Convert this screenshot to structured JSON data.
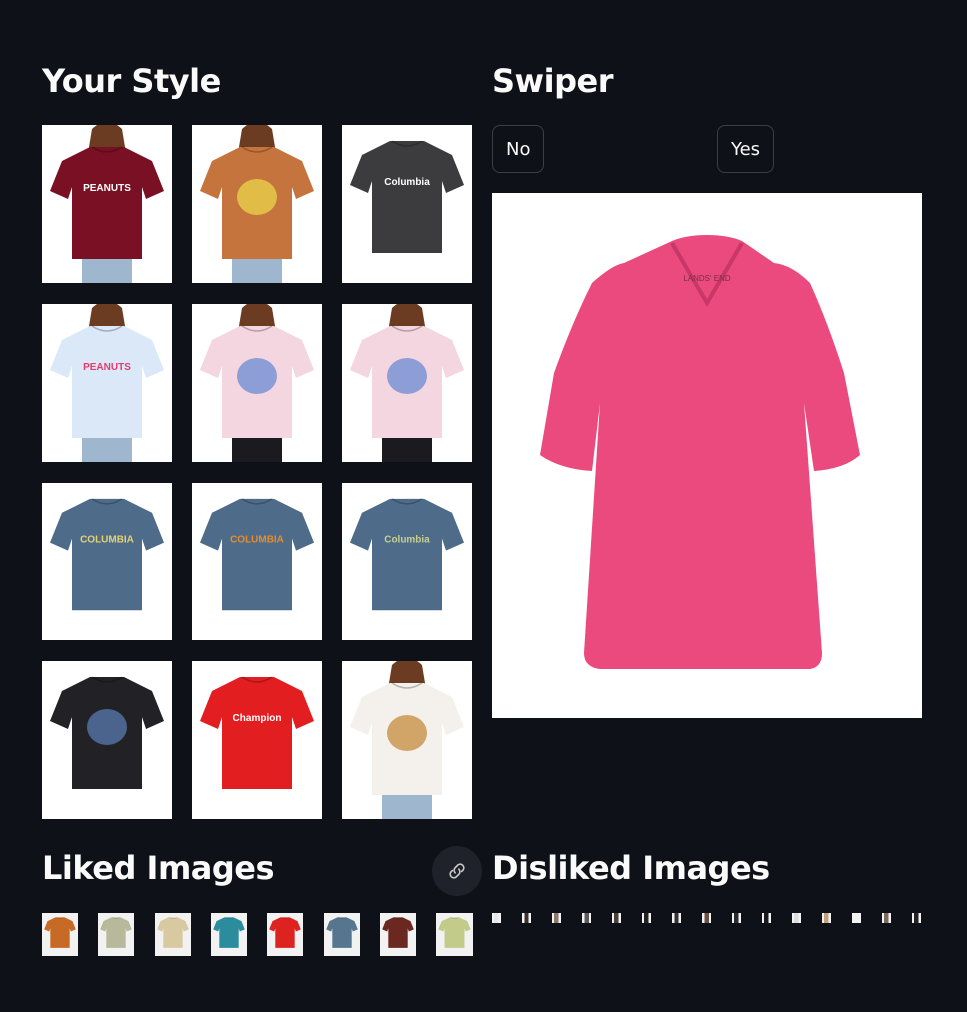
{
  "style_section": {
    "title": "Your Style"
  },
  "swiper_section": {
    "title": "Swiper",
    "no_label": "No",
    "yes_label": "Yes"
  },
  "liked_section": {
    "title": "Liked Images",
    "link_icon": "link-icon"
  },
  "disliked_section": {
    "title": "Disliked Images",
    "count": 15
  },
  "style_tiles": [
    {
      "shirt": "#7a1024",
      "kind": "model",
      "print": "PEANUTS",
      "print_color": "#ffffff"
    },
    {
      "shirt": "#c6743e",
      "kind": "model",
      "print": "",
      "print_color": "#e9d44b"
    },
    {
      "shirt": "#3c3c3e",
      "kind": "flat",
      "print": "Columbia",
      "print_color": "#ffffff"
    },
    {
      "shirt": "#dbe8f8",
      "kind": "model",
      "print": "PEANUTS",
      "print_color": "#e33b6a"
    },
    {
      "shirt": "#f3d6df",
      "kind": "model",
      "print": "",
      "print_color": "#6b8bd4"
    },
    {
      "shirt": "#f3d6df",
      "kind": "model",
      "print": "",
      "print_color": "#6b8bd4"
    },
    {
      "shirt": "#4e6c8a",
      "kind": "flat",
      "print": "COLUMBIA",
      "print_color": "#e4d271"
    },
    {
      "shirt": "#4e6c8a",
      "kind": "flat",
      "print": "COLUMBIA",
      "print_color": "#e58d2a"
    },
    {
      "shirt": "#4e6c8a",
      "kind": "flat",
      "print": "Columbia",
      "print_color": "#c8d08a"
    },
    {
      "shirt": "#222226",
      "kind": "flat",
      "print": "",
      "print_color": "#5a7bb0"
    },
    {
      "shirt": "#e21e20",
      "kind": "flat",
      "print": "Champion",
      "print_color": "#ffffff"
    },
    {
      "shirt": "#f4f1ec",
      "kind": "model",
      "print": "",
      "print_color": "#c58a3c"
    }
  ],
  "swiper_image": {
    "shirt": "#ea4a7e",
    "brand": "LANDS' END"
  },
  "liked_thumbs": [
    {
      "shirt": "#c76a26"
    },
    {
      "shirt": "#b8b89a"
    },
    {
      "shirt": "#d8c9a0"
    },
    {
      "shirt": "#2b8c9e"
    },
    {
      "shirt": "#dc2320"
    },
    {
      "shirt": "#56768f"
    },
    {
      "shirt": "#6a2820"
    },
    {
      "shirt": "#c2cb8a"
    }
  ]
}
